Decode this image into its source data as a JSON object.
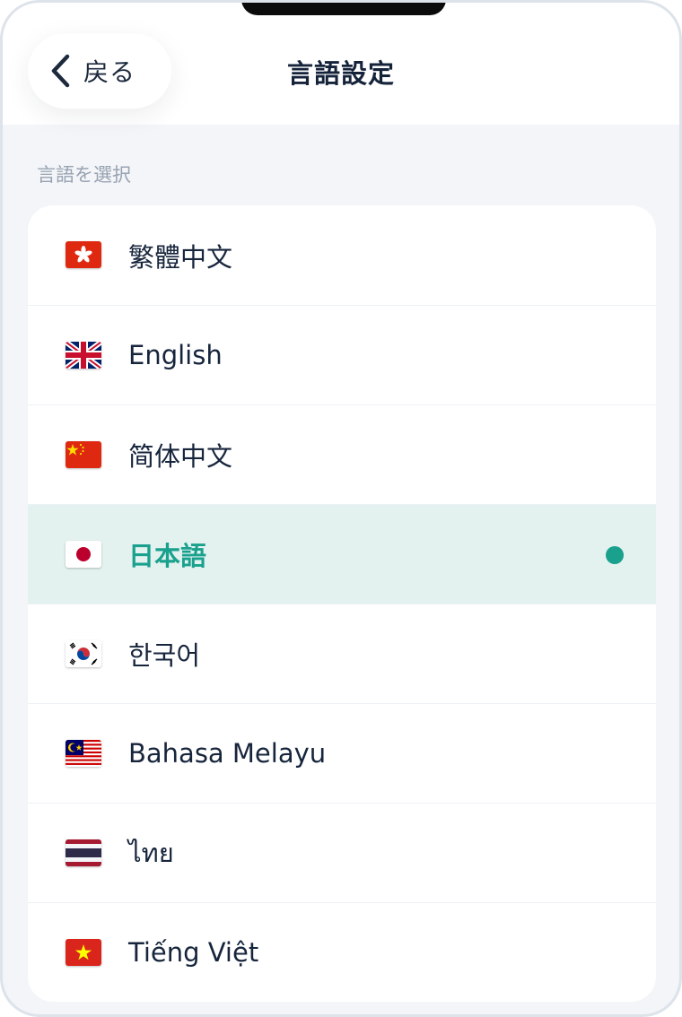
{
  "header": {
    "back_label": "戻る",
    "title": "言語設定"
  },
  "section_label": "言語を選択",
  "languages": [
    {
      "label": "繁體中文",
      "flag": "hong-kong-flag"
    },
    {
      "label": "English",
      "flag": "uk-flag"
    },
    {
      "label": "简体中文",
      "flag": "china-flag"
    },
    {
      "label": "日本語",
      "flag": "japan-flag",
      "selected": true
    },
    {
      "label": "한국어",
      "flag": "south-korea-flag"
    },
    {
      "label": "Bahasa Melayu",
      "flag": "malaysia-flag"
    },
    {
      "label": "ไทย",
      "flag": "thailand-flag"
    },
    {
      "label": "Tiếng Việt",
      "flag": "vietnam-flag"
    }
  ],
  "colors": {
    "accent": "#1aa18e",
    "selected_row_bg": "#e3f2ef",
    "text_primary": "#17253c",
    "text_muted": "#98a3b2",
    "background": "#f3f5f8"
  }
}
